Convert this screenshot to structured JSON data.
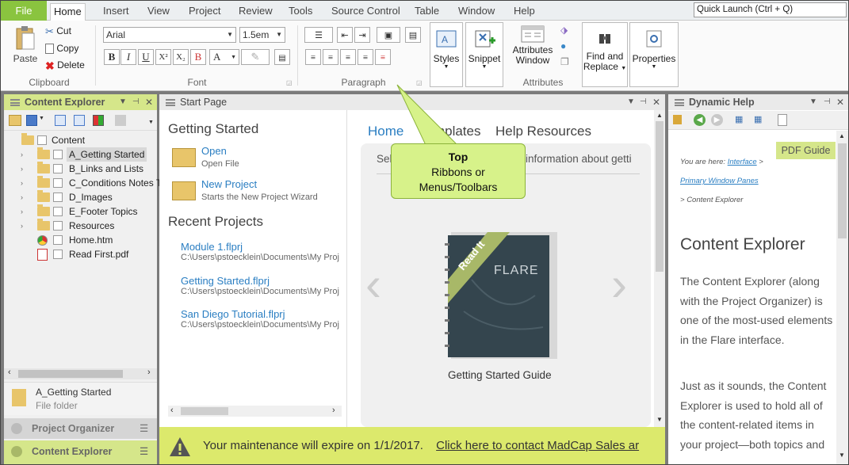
{
  "tabs": {
    "file": "File",
    "items": [
      "Home",
      "Insert",
      "View",
      "Project",
      "Review",
      "Tools",
      "Source Control",
      "Table",
      "Window",
      "Help"
    ],
    "active": "Home"
  },
  "quick_launch": {
    "placeholder": "Quick Launch (Ctrl + Q)"
  },
  "ribbon": {
    "clipboard": {
      "label": "Clipboard",
      "paste": "Paste",
      "cut": "Cut",
      "copy": "Copy",
      "delete": "Delete"
    },
    "font": {
      "label": "Font",
      "family": "Arial",
      "size": "1.5em"
    },
    "paragraph": {
      "label": "Paragraph"
    },
    "styles": "Styles",
    "snippet": "Snippet",
    "attributes": {
      "label": "Attributes",
      "window_line1": "Attributes",
      "window_line2": "Window"
    },
    "find": {
      "line1": "Find and",
      "line2": "Replace"
    },
    "properties": "Properties"
  },
  "content_explorer": {
    "title": "Content Explorer",
    "items": [
      {
        "label": "Content",
        "type": "folder-open"
      },
      {
        "label": "A_Getting Started",
        "type": "folder",
        "selected": true
      },
      {
        "label": "B_Links and Lists",
        "type": "folder"
      },
      {
        "label": "C_Conditions Notes T",
        "type": "folder"
      },
      {
        "label": "D_Images",
        "type": "folder"
      },
      {
        "label": "E_Footer Topics",
        "type": "folder"
      },
      {
        "label": "Resources",
        "type": "folder"
      },
      {
        "label": "Home.htm",
        "type": "html"
      },
      {
        "label": "Read First.pdf",
        "type": "pdf"
      }
    ],
    "detail": {
      "name": "A_Getting Started",
      "kind": "File folder"
    },
    "bottom_tabs": [
      "Project Organizer",
      "Content Explorer"
    ]
  },
  "start_page": {
    "title": "Start Page",
    "getting_started": "Getting Started",
    "open": {
      "label": "Open",
      "desc": "Open File"
    },
    "new_project": {
      "label": "New Project",
      "desc": "Starts the New Project Wizard"
    },
    "recent_title": "Recent Projects",
    "recent": [
      {
        "name": "Module 1.flprj",
        "path": "C:\\Users\\pstoecklein\\Documents\\My Proj"
      },
      {
        "name": "Getting Started.flprj",
        "path": "C:\\Users\\pstoecklein\\Documents\\My Proj"
      },
      {
        "name": "San Diego Tutorial.flprj",
        "path": "C:\\Users\\pstoecklein\\Documents\\My Proj"
      }
    ],
    "nav": [
      "Home",
      "Templates",
      "Help Resources"
    ],
    "intro_left": "Sel",
    "intro_right": "information about getti",
    "book": {
      "ribbon": "Read It",
      "brand": "FLARE",
      "caption": "Getting Started Guide"
    }
  },
  "banner": {
    "text": "Your maintenance will expire on 1/1/2017.",
    "link": "Click here to contact MadCap Sales ar"
  },
  "dynamic_help": {
    "title": "Dynamic Help",
    "pdf_guide": "PDF Guide",
    "you_are_here": "You are here:",
    "crumb1": "Interface",
    "crumb2": "Primary Window Panes",
    "crumb3": "Content Explorer",
    "heading": "Content Explorer",
    "para1": "The Content Explorer (along with the Project Organizer) is one of the most-used elements in the Flare interface.",
    "para2": "Just as it sounds, the Content Explorer is used to hold all of the content-related items in your project—both topics and"
  },
  "callout": {
    "title": "Top",
    "line1": "Ribbons or",
    "line2": "Menus/Toolbars"
  }
}
